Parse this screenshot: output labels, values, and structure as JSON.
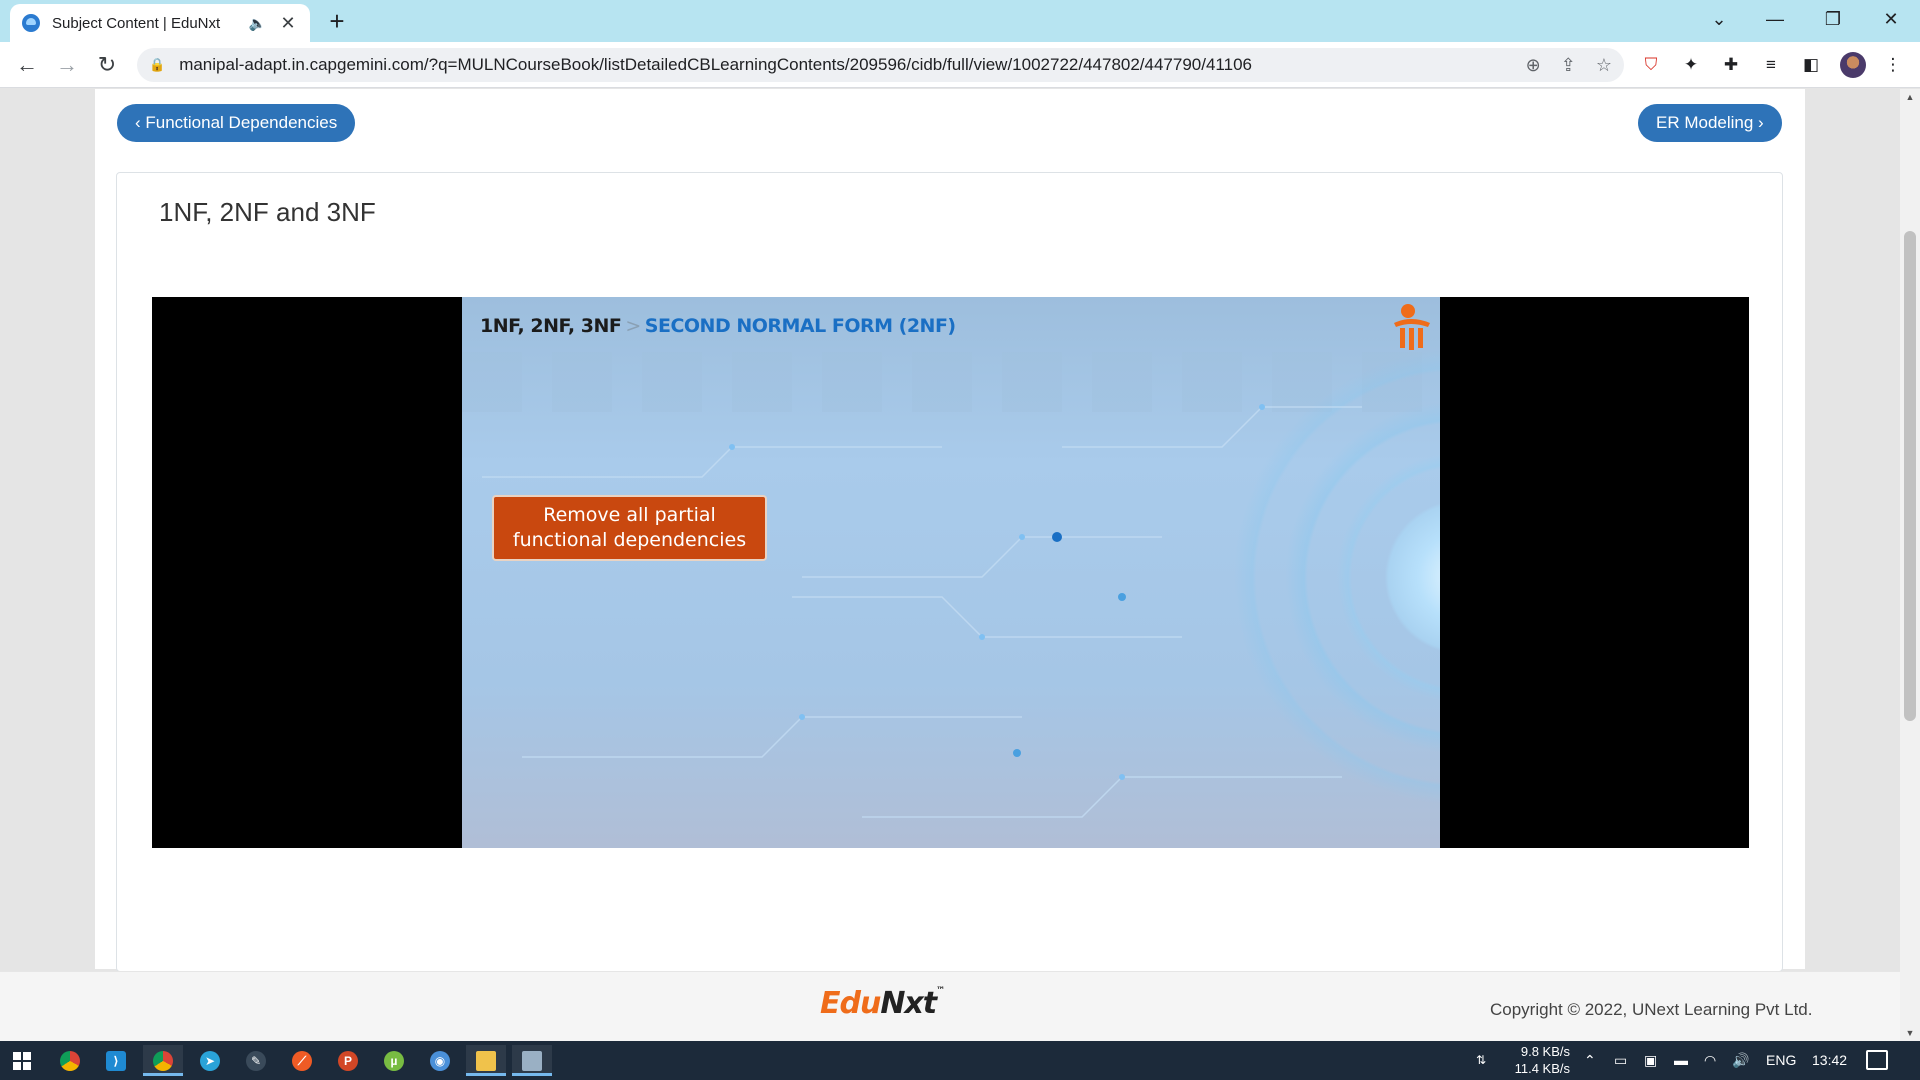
{
  "browser": {
    "tab": {
      "title": "Subject Content | EduNxt",
      "audio_icon": "speaker-icon",
      "close_icon": "close-icon"
    },
    "new_tab_label": "+",
    "url": "manipal-adapt.in.capgemini.com/?q=MULNCourseBook/listDetailedCBLearningContents/209596/cidb/full/view/1002722/447802/447790/41106"
  },
  "page": {
    "prev_button": "‹ Functional Dependencies",
    "next_button": "ER Modeling ›",
    "card_title": "1NF, 2NF and 3NF",
    "video": {
      "crumb": "1NF, 2NF, 3NF",
      "separator": ">",
      "section": "SECOND NORMAL FORM (2NF)",
      "callout": "Remove all partial functional dependencies"
    }
  },
  "footer": {
    "logo_edu": "Edu",
    "logo_nxt": "Nxt",
    "logo_tm": "™",
    "copyright": "Copyright © 2022, UNext Learning Pvt Ltd."
  },
  "taskbar": {
    "net_up": "9.8 KB/s",
    "net_down": "11.4 KB/s",
    "language": "ENG",
    "time": "13:42",
    "apps": [
      "windows-start",
      "chrome",
      "vscode",
      "chrome-active",
      "telegram",
      "inkscape",
      "postman",
      "powerpoint",
      "utorrent",
      "chromium",
      "file-explorer",
      "monitor"
    ]
  },
  "colors": {
    "accent_blue": "#2e73b8",
    "callout_orange": "#c9480f",
    "tab_bar": "#b7e4f1",
    "taskbar": "#1c2a3a"
  }
}
